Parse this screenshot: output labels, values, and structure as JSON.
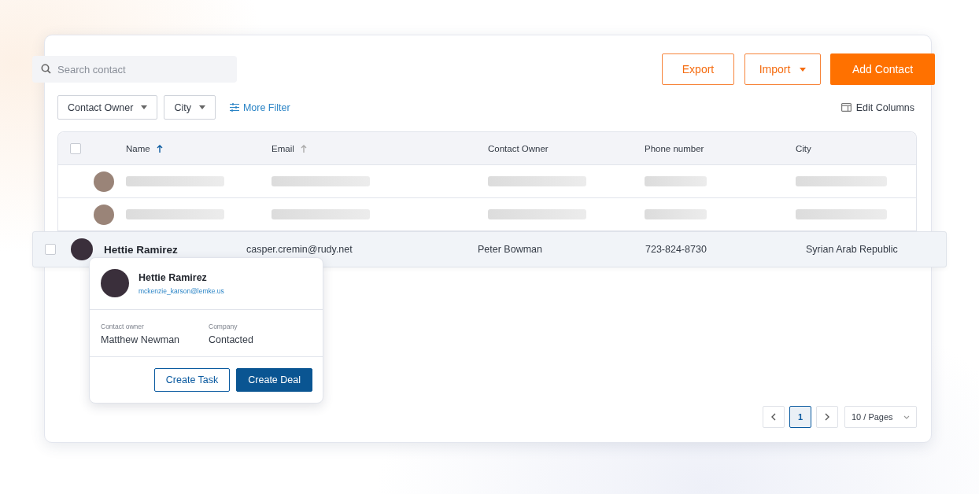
{
  "search": {
    "placeholder": "Search contact"
  },
  "actions": [
    {
      "label": "Export",
      "kind": "outline"
    },
    {
      "label": "Import",
      "kind": "dropdown"
    },
    {
      "label": "Add Contact",
      "kind": "primary"
    }
  ],
  "filters": [
    {
      "label": "Contact Owner"
    },
    {
      "label": "City"
    }
  ],
  "more_filter": "More Filter",
  "edit_columns": "Edit Columns",
  "table": {
    "header_checked": false,
    "columns": [
      {
        "label": "Name",
        "sort_active": true
      },
      {
        "label": "Email",
        "sort_active": false
      },
      {
        "label": "Contact Owner"
      },
      {
        "label": "Phone number"
      },
      {
        "label": "City"
      }
    ],
    "rows": [
      {
        "kind": "placeholder"
      },
      {
        "kind": "placeholder"
      },
      {
        "kind": "contact",
        "checked": false,
        "name": "Hettie Ramirez",
        "email": "casper.cremin@rudy.net",
        "owner": "Peter Bowman",
        "phone": "723-824-8730",
        "city": "Syrian Arab Republic"
      }
    ]
  },
  "popover": {
    "name": "Hettie Ramirez",
    "email": "mckenzie_karson@lemke.us",
    "fields": [
      {
        "label": "Contact owner",
        "value": "Matthew Newman"
      },
      {
        "label": "Company",
        "value": "Contacted"
      }
    ],
    "buttons": [
      {
        "label": "Create Task",
        "kind": "outline"
      },
      {
        "label": "Create Deal",
        "kind": "primary"
      }
    ]
  },
  "pagination": {
    "pages": [
      {
        "label": "1",
        "selected": true
      }
    ],
    "page_size": "10 / Pages"
  }
}
